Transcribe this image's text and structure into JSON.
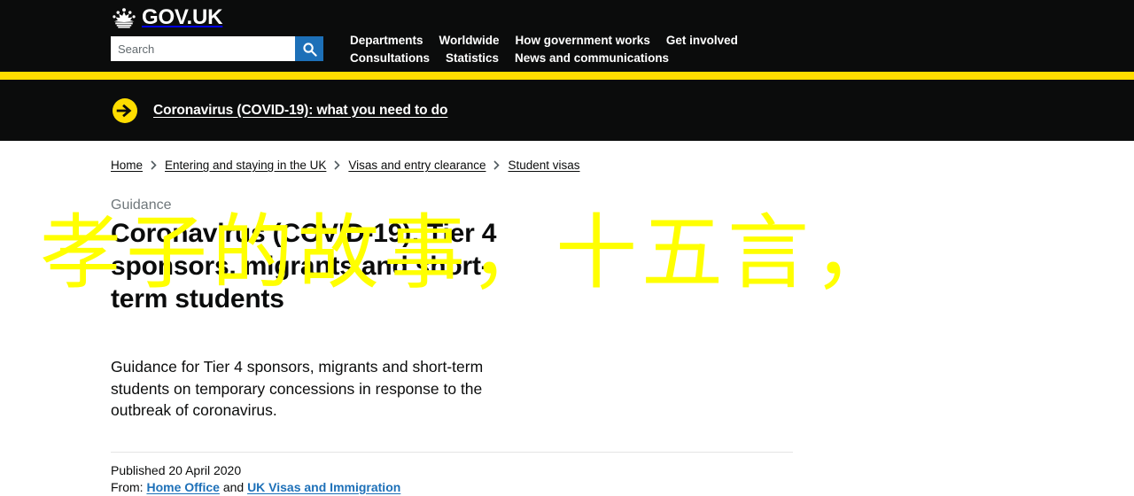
{
  "header": {
    "logo_text": "GOV.UK",
    "crown_icon": "crown-icon",
    "search": {
      "placeholder": "Search",
      "value": "",
      "button_icon": "search-icon"
    },
    "nav_row_1": [
      "Departments",
      "Worldwide",
      "How government works",
      "Get involved"
    ],
    "nav_row_2": [
      "Consultations",
      "Statistics",
      "News and communications"
    ]
  },
  "banner": {
    "arrow_icon": "arrow-right-circle-icon",
    "link_text": "Coronavirus (COVID-19): what you need to do"
  },
  "breadcrumb": [
    "Home",
    "Entering and staying in the UK",
    "Visas and entry clearance",
    "Student visas"
  ],
  "main": {
    "guidance_label": "Guidance",
    "title": "Coronavirus (COVID-19): Tier 4 sponsors, migrants and short-term students",
    "description": "Guidance for Tier 4 sponsors, migrants and short-term students on temporary concessions in response to the outbreak of coronavirus.",
    "published": "Published 20 April 2020",
    "from_prefix": "From:",
    "from_link_1": "Home Office",
    "from_conjunction": "and",
    "from_link_2": "UK Visas and Immigration"
  },
  "overlay": {
    "text": "孝子的故事，十五言，"
  },
  "colors": {
    "black": "#0b0c0c",
    "yellow": "#ffdd00",
    "overlay_yellow": "#ffff00",
    "link_blue": "#1d70b8",
    "grey_text": "#6f777b"
  }
}
